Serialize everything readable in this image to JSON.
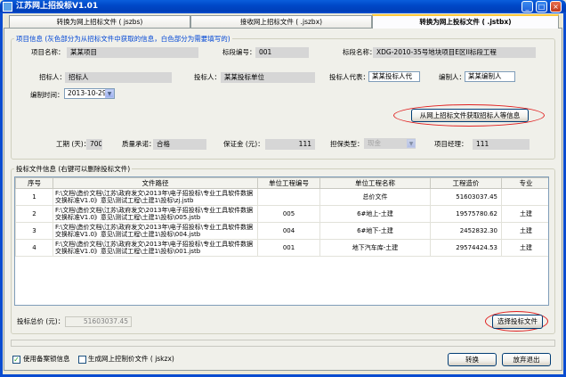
{
  "window": {
    "title": "江苏网上招投标V1.01",
    "controls": {
      "minimize": "_",
      "maximize": "□",
      "close": "×"
    }
  },
  "tabs": [
    {
      "label": "转换为网上招标文件 ( jszbs)"
    },
    {
      "label": "接收网上招标文件 ( .jszbx)"
    },
    {
      "label": "转换为网上投标文件 ( .jstbx)",
      "active": true
    }
  ],
  "project_info": {
    "legend": "项目信息 (灰色部分为从招标文件中获取的信息，白色部分为需要填写的)",
    "project_name_label": "项目名称：",
    "project_name": "某某项目",
    "section_no_label": "标段编号：",
    "section_no": "001",
    "section_name_label": "标段名称：",
    "section_name": "XDG-2010-35号地块项目E区II标段工程",
    "tenderer_label": "招标人：",
    "tenderer": "招标人",
    "bidder_label": "投标人：",
    "bidder": "某某投标单位",
    "bidder_rep_label": "投标人代表：",
    "bidder_rep": "某某投标人代",
    "preparer_label": "编制人：",
    "preparer": "某某编制人",
    "prep_time_label": "编制时间：",
    "prep_time": "2013-10-29",
    "fetch_button": "从网上招标文件获取招标人等信息",
    "duration_label": "工期 (天)：",
    "duration": "700",
    "quality_label": "质量承诺：",
    "quality": "合格",
    "deposit_label": "保证金 (元)：",
    "deposit": "111",
    "guarantee_type_label": "担保类型：",
    "guarantee_type": "现金",
    "pm_label": "项目经理：",
    "pm": "111"
  },
  "bid_files": {
    "legend": "投标文件信息 (右键可以删除投标文件)",
    "columns": [
      "序号",
      "文件路径",
      "单位工程编号",
      "单位工程名称",
      "工程造价",
      "专业"
    ],
    "rows": [
      {
        "no": "1",
        "path": "F:\\文档\\造价文档\\江苏\\政府发文\\2013年\\电子招投标\\专业工具软件数据交换标准V1.0》意见\\测试工程\\土建1\\投标\\zj.jstb",
        "unit_no": "",
        "unit_name": "总价文件",
        "cost": "51603037.45",
        "major": ""
      },
      {
        "no": "2",
        "path": "F:\\文档\\造价文档\\江苏\\政府发文\\2013年\\电子招投标\\专业工具软件数据交换标准V1.0》意见\\测试工程\\土建1\\投标\\005.jstb",
        "unit_no": "005",
        "unit_name": "6#地上-土建",
        "cost": "19575780.62",
        "major": "土建"
      },
      {
        "no": "3",
        "path": "F:\\文档\\造价文档\\江苏\\政府发文\\2013年\\电子招投标\\专业工具软件数据交换标准V1.0》意见\\测试工程\\土建1\\投标\\004.jstb",
        "unit_no": "004",
        "unit_name": "6#地下-土建",
        "cost": "2452832.30",
        "major": "土建"
      },
      {
        "no": "4",
        "path": "F:\\文档\\造价文档\\江苏\\政府发文\\2013年\\电子招投标\\专业工具软件数据交换标准V1.0》意见\\测试工程\\土建1\\投标\\001.jstb",
        "unit_no": "001",
        "unit_name": "地下汽车库-土建",
        "cost": "29574424.53",
        "major": "土建"
      }
    ],
    "total_label": "投标总价 (元)：",
    "total": "51603037.45",
    "select_button": "选择投标文件"
  },
  "footer": {
    "use_record_label": "使用备案锁信息",
    "use_record_checked": true,
    "gen_control_label": "生成网上控制价文件 ( jskzx)",
    "gen_control_checked": false,
    "convert_button": "转换",
    "exit_button": "放弃退出"
  },
  "colors": {
    "titlebar": "#0048C8",
    "panel": "#F0F0EA",
    "readonly_field": "#D6D6D6",
    "legend_blue": "#0046D5",
    "highlight_oval": "#E02020"
  }
}
